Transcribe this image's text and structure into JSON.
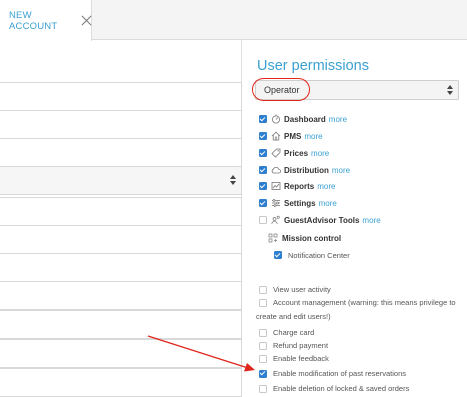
{
  "tab": {
    "label": "NEW ACCOUNT"
  },
  "permissions": {
    "title": "User permissions",
    "role": "Operator",
    "more_label": "more",
    "modules": [
      {
        "name": "Dashboard",
        "checked": true,
        "icon": "dashboard-icon",
        "more": true
      },
      {
        "name": "PMS",
        "checked": true,
        "icon": "home-icon",
        "more": true
      },
      {
        "name": "Prices",
        "checked": true,
        "icon": "tag-icon",
        "more": true
      },
      {
        "name": "Distribution",
        "checked": true,
        "icon": "cloud-icon",
        "more": true
      },
      {
        "name": "Reports",
        "checked": true,
        "icon": "chart-icon",
        "more": true
      },
      {
        "name": "Settings",
        "checked": true,
        "icon": "sliders-icon",
        "more": true
      },
      {
        "name": "GuestAdvisor Tools",
        "checked": false,
        "icon": "users-icon",
        "more": true
      }
    ],
    "mission_control": {
      "name": "Mission control",
      "icon": "grid-icon",
      "sub_option": {
        "label": "Notification Center",
        "checked": true
      }
    },
    "options": [
      {
        "label": "View user activity",
        "checked": false
      },
      {
        "label": "Account management (warning: this means privilege to",
        "checked": false
      },
      {
        "label": "Charge card",
        "checked": false
      },
      {
        "label": "Refund payment",
        "checked": false
      },
      {
        "label": "Enable feedback",
        "checked": false
      },
      {
        "label": "Enable modification of past reservations",
        "checked": true
      },
      {
        "label": "Enable deletion of locked & saved orders",
        "checked": false
      }
    ],
    "account_management_wrap": "create and edit users!)"
  },
  "colors": {
    "accent": "#3aa0d2",
    "checkbox": "#2e7fcf",
    "annotation": "#e0251b"
  }
}
